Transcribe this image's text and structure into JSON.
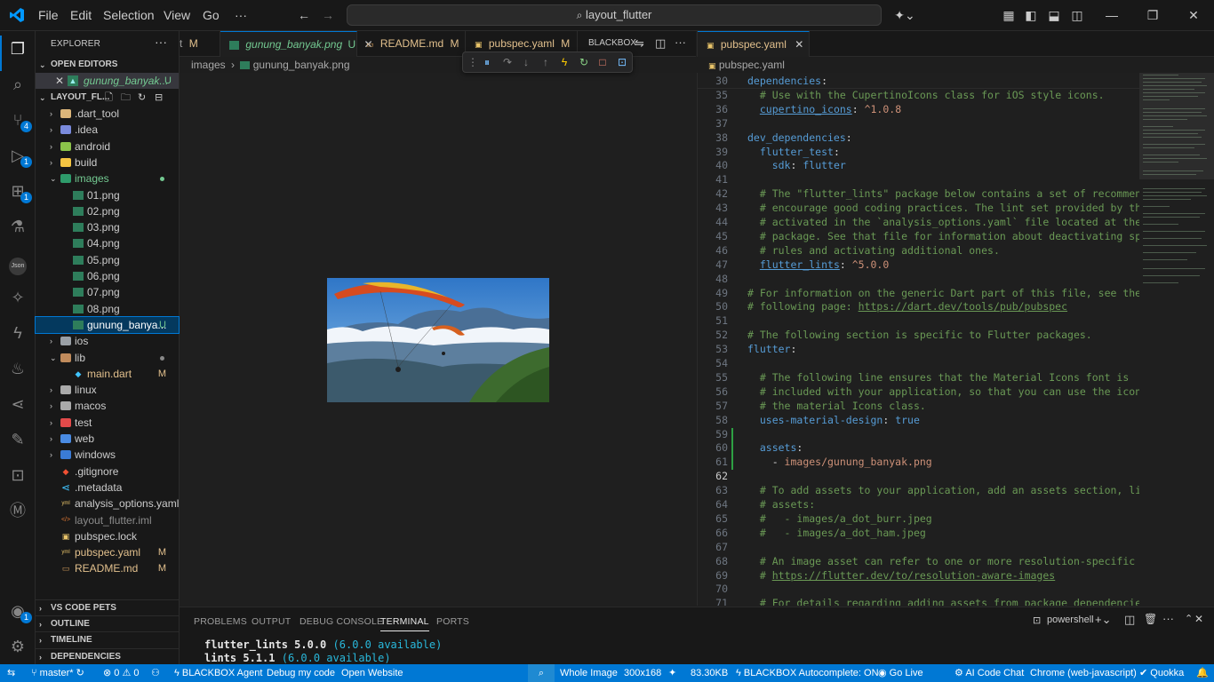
{
  "menu": [
    "File",
    "Edit",
    "Selection",
    "View",
    "Go",
    "···"
  ],
  "search": {
    "text": "layout_flutter"
  },
  "activity": {
    "scm_badge": "4",
    "run_badge": "1",
    "ext_badge": "1",
    "account_badge": "1"
  },
  "sidebar": {
    "title": "EXPLORER",
    "open_editors": "OPEN EDITORS",
    "open_file": "gunung_banyak...",
    "open_file_status": "U",
    "project": "LAYOUT_FL...",
    "outline": "OUTLINE",
    "timeline": "TIMELINE",
    "dependencies": "DEPENDENCIES",
    "pets": "VS CODE PETS",
    "tree": [
      {
        "name": ".dart_tool",
        "status": ""
      },
      {
        "name": ".idea",
        "status": ""
      },
      {
        "name": "android",
        "status": ""
      },
      {
        "name": "build",
        "status": ""
      },
      {
        "name": "images",
        "status": ""
      },
      {
        "name": "01.png",
        "status": ""
      },
      {
        "name": "02.png",
        "status": ""
      },
      {
        "name": "03.png",
        "status": ""
      },
      {
        "name": "04.png",
        "status": ""
      },
      {
        "name": "05.png",
        "status": ""
      },
      {
        "name": "06.png",
        "status": ""
      },
      {
        "name": "07.png",
        "status": ""
      },
      {
        "name": "08.png",
        "status": ""
      },
      {
        "name": "gunung_banya...",
        "status": "U"
      },
      {
        "name": "ios",
        "status": ""
      },
      {
        "name": "lib",
        "status": ""
      },
      {
        "name": "main.dart",
        "status": "M"
      },
      {
        "name": "linux",
        "status": ""
      },
      {
        "name": "macos",
        "status": ""
      },
      {
        "name": "test",
        "status": ""
      },
      {
        "name": "web",
        "status": ""
      },
      {
        "name": "windows",
        "status": ""
      },
      {
        "name": ".gitignore",
        "status": ""
      },
      {
        "name": ".metadata",
        "status": ""
      },
      {
        "name": "analysis_options.yaml",
        "status": ""
      },
      {
        "name": "layout_flutter.iml",
        "status": ""
      },
      {
        "name": "pubspec.lock",
        "status": ""
      },
      {
        "name": "pubspec.yaml",
        "status": "M"
      },
      {
        "name": "README.md",
        "status": "M"
      }
    ]
  },
  "editor1": {
    "tabs": [
      {
        "label": "t",
        "status": "M"
      },
      {
        "label": "gunung_banyak.png",
        "status": "U"
      },
      {
        "label": "README.md",
        "status": "M"
      },
      {
        "label": "pubspec.yaml",
        "status": "M"
      }
    ],
    "blackbox": "BLACKBOX",
    "breadcrumb": [
      "images",
      "gunung_banyak.png"
    ]
  },
  "editor2": {
    "tab": "pubspec.yaml",
    "breadcrumb": "pubspec.yaml",
    "lines": [
      {
        "n": "30",
        "t": "dependencies:"
      },
      {
        "n": "35",
        "t": "  # Use with the CupertinoIcons class for iOS style icons."
      },
      {
        "n": "36",
        "t": "  cupertino_icons: ^1.0.8"
      },
      {
        "n": "37",
        "t": ""
      },
      {
        "n": "38",
        "t": "dev_dependencies:"
      },
      {
        "n": "39",
        "t": "  flutter_test:"
      },
      {
        "n": "40",
        "t": "    sdk: flutter"
      },
      {
        "n": "41",
        "t": ""
      },
      {
        "n": "42",
        "t": "  # The \"flutter_lints\" package below contains a set of recommended"
      },
      {
        "n": "43",
        "t": "  # encourage good coding practices. The lint set provided by the pac"
      },
      {
        "n": "44",
        "t": "  # activated in the `analysis_options.yaml` file located at the root"
      },
      {
        "n": "45",
        "t": "  # package. See that file for information about deactivating specif"
      },
      {
        "n": "46",
        "t": "  # rules and activating additional ones."
      },
      {
        "n": "47",
        "t": "  flutter_lints: ^5.0.0"
      },
      {
        "n": "48",
        "t": ""
      },
      {
        "n": "49",
        "t": "# For information on the generic Dart part of this file, see the"
      },
      {
        "n": "50",
        "t": "# following page: https://dart.dev/tools/pub/pubspec"
      },
      {
        "n": "51",
        "t": ""
      },
      {
        "n": "52",
        "t": "# The following section is specific to Flutter packages."
      },
      {
        "n": "53",
        "t": "flutter:"
      },
      {
        "n": "54",
        "t": ""
      },
      {
        "n": "55",
        "t": "  # The following line ensures that the Material Icons font is"
      },
      {
        "n": "56",
        "t": "  # included with your application, so that you can use the icons in"
      },
      {
        "n": "57",
        "t": "  # the material Icons class."
      },
      {
        "n": "58",
        "t": "  uses-material-design: true"
      },
      {
        "n": "59",
        "t": ""
      },
      {
        "n": "60",
        "t": "  assets:"
      },
      {
        "n": "61",
        "t": "    - images/gunung_banyak.png"
      },
      {
        "n": "62",
        "t": ""
      },
      {
        "n": "63",
        "t": "  # To add assets to your application, add an assets section, like th"
      },
      {
        "n": "64",
        "t": "  # assets:"
      },
      {
        "n": "65",
        "t": "  #   - images/a_dot_burr.jpeg"
      },
      {
        "n": "66",
        "t": "  #   - images/a_dot_ham.jpeg"
      },
      {
        "n": "67",
        "t": ""
      },
      {
        "n": "68",
        "t": "  # An image asset can refer to one or more resolution-specific \"var"
      },
      {
        "n": "69",
        "t": "  # https://flutter.dev/to/resolution-aware-images"
      },
      {
        "n": "70",
        "t": ""
      },
      {
        "n": "71",
        "t": "  # For details regarding adding assets from package dependencies, se"
      }
    ]
  },
  "panel": {
    "tabs": [
      "PROBLEMS",
      "OUTPUT",
      "DEBUG CONSOLE",
      "TERMINAL",
      "PORTS"
    ],
    "shell": "powershell",
    "term_lines": [
      {
        "pkg": "flutter_lints 5.0.0",
        "avail": "(6.0.0 available)"
      },
      {
        "pkg": "lints 5.1.1",
        "avail": "(6.0.0 available)"
      }
    ]
  },
  "status": {
    "branch": "master*",
    "problems": "0",
    "warnings": "0",
    "blackbox_agent": "BLACKBOX Agent",
    "debug": "Debug my code",
    "website": "Open Website",
    "whole_image": "Whole Image",
    "dims": "300x168",
    "size": "83.30KB",
    "autocomplete": "BLACKBOX Autocomplete: ON",
    "golive": "Go Live",
    "aichat": "AI Code Chat",
    "chrome": "Chrome (web-javascript)",
    "quokka": "Quokka"
  },
  "colors": {
    "accent": "#0078d4",
    "modified": "#e2c08d",
    "untracked": "#73c991"
  }
}
